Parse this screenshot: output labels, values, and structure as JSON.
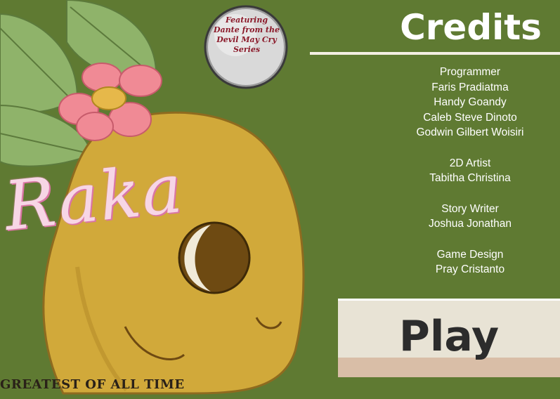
{
  "game": {
    "title": "Raka",
    "tagline": "GREATEST OF ALL TIME",
    "badge": {
      "lines": [
        "Featuring",
        "Dante from the",
        "Devil May Cry",
        "Series"
      ]
    }
  },
  "credits": {
    "heading": "Credits",
    "sections": [
      {
        "role": "Programmer",
        "names": [
          "Faris Pradiatma",
          "Handy Goandy",
          "Caleb Steve Dinoto",
          "Godwin Gilbert Woisiri"
        ]
      },
      {
        "role": "2D Artist",
        "names": [
          "Tabitha Christina"
        ]
      },
      {
        "role": "Story Writer",
        "names": [
          "Joshua Jonathan"
        ]
      },
      {
        "role": "Game Design",
        "names": [
          "Pray Cristanto"
        ]
      }
    ]
  },
  "menu": {
    "play_label": "Play"
  },
  "colors": {
    "background": "#5f7a32",
    "leaf": "#8fb36a",
    "petal": "#f08a95",
    "flower_center": "#e6b84a",
    "character_body": "#d1a93a",
    "title_pink": "#f7d6e6",
    "button_bg": "#e8e3d5",
    "button_band": "#d9bea7"
  }
}
